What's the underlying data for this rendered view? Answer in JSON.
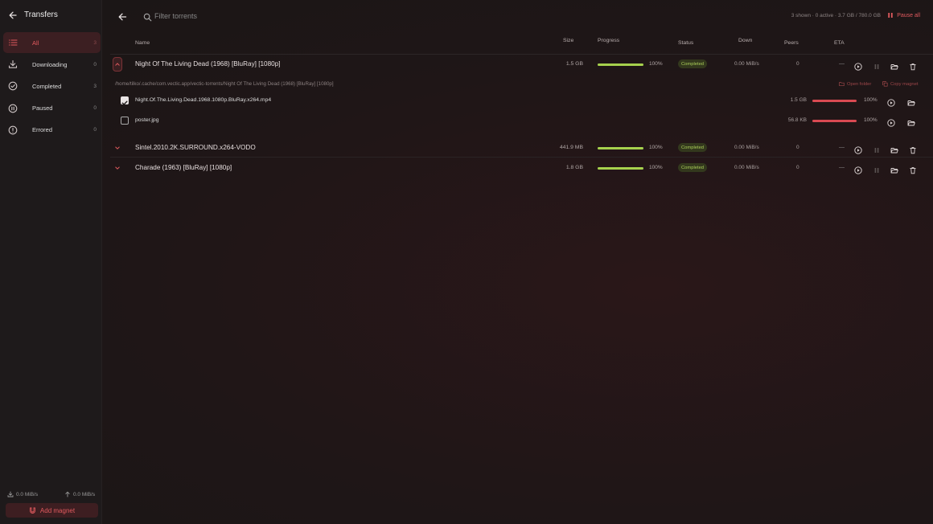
{
  "sidebar": {
    "title": "Transfers",
    "items": [
      {
        "label": "All",
        "count": "3",
        "icon": "list-icon",
        "active": true
      },
      {
        "label": "Downloading",
        "count": "0",
        "icon": "download-icon",
        "active": false
      },
      {
        "label": "Completed",
        "count": "3",
        "icon": "check-circle-icon",
        "active": false
      },
      {
        "label": "Paused",
        "count": "0",
        "icon": "pause-circle-icon",
        "active": false
      },
      {
        "label": "Errored",
        "count": "0",
        "icon": "alert-circle-icon",
        "active": false
      }
    ],
    "down_speed": "0.0 MiB/s",
    "up_speed": "0.0 MiB/s",
    "add_magnet_label": "Add magnet"
  },
  "topbar": {
    "search_placeholder": "Filter torrents",
    "stats": "3 shown · 0 active · 3.7 GB / 780.0 GB",
    "pause_all_label": "Pause all"
  },
  "columns": {
    "name": "Name",
    "size": "Size",
    "progress": "Progress",
    "status": "Status",
    "down": "Down",
    "peers": "Peers",
    "eta": "ETA"
  },
  "torrents": [
    {
      "name": "Night Of The Living Dead (1968) [BluRay] [1080p]",
      "size": "1.5 GB",
      "progress": 1.0,
      "progress_label": "100%",
      "status": "Completed",
      "down": "0.00 MiB/s",
      "peers": "0",
      "eta": "—",
      "expanded": true
    },
    {
      "name": "Sintel.2010.2K.SURROUND.x264-VODO",
      "size": "441.9 MB",
      "progress": 1.0,
      "progress_label": "100%",
      "status": "Completed",
      "down": "0.00 MiB/s",
      "peers": "0",
      "eta": "—",
      "expanded": false
    },
    {
      "name": "Charade (1963) [BluRay] [1080p]",
      "size": "1.8 GB",
      "progress": 1.0,
      "progress_label": "100%",
      "status": "Completed",
      "down": "0.00 MiB/s",
      "peers": "0",
      "eta": "—",
      "expanded": false
    }
  ],
  "detail": {
    "path": "/home/tilko/.cache/com.vectic.app/vectic-torrents/Night Of The Living Dead (1968) [BluRay] [1080p]",
    "open_folder_label": "Open folder",
    "copy_magnet_label": "Copy magnet",
    "files": [
      {
        "name": "Night.Of.The.Living.Dead.1968.1080p.BluRay.x264.mp4",
        "size": "1.5 GB",
        "progress": 1.0,
        "progress_label": "100%",
        "checked": true
      },
      {
        "name": "poster.jpg",
        "size": "56.8 KB",
        "progress": 1.0,
        "progress_label": "100%",
        "checked": false
      }
    ]
  },
  "colors": {
    "accent": "#e05a5e",
    "progress_green": "#a6d14d",
    "file_progress_red": "#d94a52",
    "status_completed": "#a9cc58"
  }
}
